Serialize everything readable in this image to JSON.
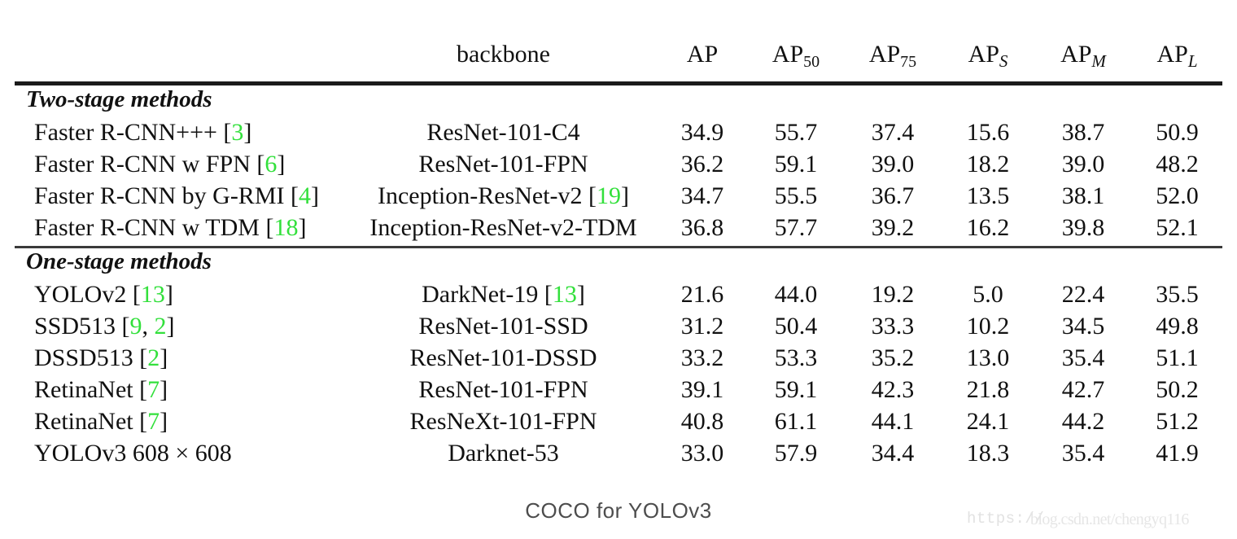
{
  "caption": "COCO for YOLOv3",
  "watermark": {
    "line1": "https://",
    "line2": "blog.csdn.net/chengyq116"
  },
  "colors": {
    "citation_green": "#33e03c",
    "rule": "#1b1b1b",
    "text": "#111111",
    "caption": "#4d4d4d",
    "watermark": "#e2e2e2"
  },
  "table": {
    "headers": {
      "method": "",
      "backbone": "backbone",
      "ap": "AP",
      "ap50_base": "AP",
      "ap50_sub": "50",
      "ap75_base": "AP",
      "ap75_sub": "75",
      "aps_base": "AP",
      "aps_sub": "S",
      "apm_base": "AP",
      "apm_sub": "M",
      "apl_base": "AP",
      "apl_sub": "L"
    },
    "sections": [
      {
        "label": "Two-stage methods",
        "rows": [
          {
            "method_text": "Faster R-CNN+++ ",
            "method_cite": "3",
            "backbone_text": "ResNet-101-C4",
            "backbone_cite": null,
            "ap": "34.9",
            "ap50": "55.7",
            "ap75": "37.4",
            "aps": "15.6",
            "apm": "38.7",
            "apl": "50.9",
            "bold": []
          },
          {
            "method_text": "Faster R-CNN w FPN ",
            "method_cite": "6",
            "backbone_text": "ResNet-101-FPN",
            "backbone_cite": null,
            "ap": "36.2",
            "ap50": "59.1",
            "ap75": "39.0",
            "aps": "18.2",
            "apm": "39.0",
            "apl": "48.2",
            "bold": []
          },
          {
            "method_text": "Faster R-CNN by G-RMI ",
            "method_cite": "4",
            "backbone_text": "Inception-ResNet-v2 ",
            "backbone_cite": "19",
            "ap": "34.7",
            "ap50": "55.5",
            "ap75": "36.7",
            "aps": "13.5",
            "apm": "38.1",
            "apl": "52.0",
            "bold": []
          },
          {
            "method_text": "Faster R-CNN w TDM ",
            "method_cite": "18",
            "backbone_text": "Inception-ResNet-v2-TDM",
            "backbone_cite": null,
            "ap": "36.8",
            "ap50": "57.7",
            "ap75": "39.2",
            "aps": "16.2",
            "apm": "39.8",
            "apl": "52.1",
            "bold": [
              "apl"
            ]
          }
        ]
      },
      {
        "label": "One-stage methods",
        "rows": [
          {
            "method_text": "YOLOv2 ",
            "method_cite": "13",
            "backbone_text": "DarkNet-19 ",
            "backbone_cite": "13",
            "ap": "21.6",
            "ap50": "44.0",
            "ap75": "19.2",
            "aps": "5.0",
            "apm": "22.4",
            "apl": "35.5",
            "bold": []
          },
          {
            "method_text": "SSD513 ",
            "method_cite": "9, 2",
            "backbone_text": "ResNet-101-SSD",
            "backbone_cite": null,
            "ap": "31.2",
            "ap50": "50.4",
            "ap75": "33.3",
            "aps": "10.2",
            "apm": "34.5",
            "apl": "49.8",
            "bold": []
          },
          {
            "method_text": "DSSD513 ",
            "method_cite": "2",
            "backbone_text": "ResNet-101-DSSD",
            "backbone_cite": null,
            "ap": "33.2",
            "ap50": "53.3",
            "ap75": "35.2",
            "aps": "13.0",
            "apm": "35.4",
            "apl": "51.1",
            "bold": []
          },
          {
            "method_text": "RetinaNet ",
            "method_cite": "7",
            "backbone_text": "ResNet-101-FPN",
            "backbone_cite": null,
            "ap": "39.1",
            "ap50": "59.1",
            "ap75": "42.3",
            "aps": "21.8",
            "apm": "42.7",
            "apl": "50.2",
            "bold": []
          },
          {
            "method_text": "RetinaNet ",
            "method_cite": "7",
            "backbone_text": "ResNeXt-101-FPN",
            "backbone_cite": null,
            "ap": "40.8",
            "ap50": "61.1",
            "ap75": "44.1",
            "aps": "24.1",
            "apm": "44.2",
            "apl": "51.2",
            "bold": [
              "ap",
              "ap50",
              "ap75",
              "aps",
              "apm"
            ]
          },
          {
            "method_text": "YOLOv3 608 × 608",
            "method_cite": null,
            "backbone_text": "Darknet-53",
            "backbone_cite": null,
            "ap": "33.0",
            "ap50": "57.9",
            "ap75": "34.4",
            "aps": "18.3",
            "apm": "35.4",
            "apl": "41.9",
            "bold": []
          }
        ]
      }
    ]
  }
}
